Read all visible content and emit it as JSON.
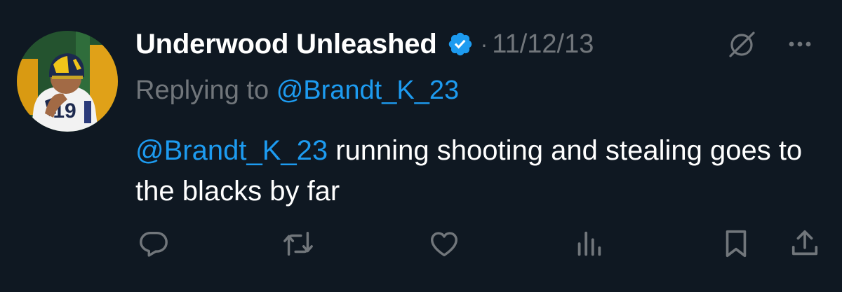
{
  "tweet": {
    "author_name": "Underwood Unleashed",
    "separator": "·",
    "date": "11/12/13",
    "replying_prefix": "Replying to",
    "replying_handle": "@Brandt_K_23",
    "mention": "@Brandt_K_23",
    "text": " running shooting and stealing goes to the blacks by far",
    "avatar_jersey_number": "19"
  },
  "icons": {
    "verified": "verified-badge-icon",
    "grok": "grok-icon",
    "more": "more-icon",
    "reply": "reply-icon",
    "retweet": "retweet-icon",
    "like": "like-icon",
    "views": "views-icon",
    "bookmark": "bookmark-icon",
    "share": "share-icon"
  },
  "colors": {
    "background": "#0f1822",
    "accent": "#1d9bf0",
    "secondary_text": "#71767b",
    "primary_text": "#ffffff"
  }
}
